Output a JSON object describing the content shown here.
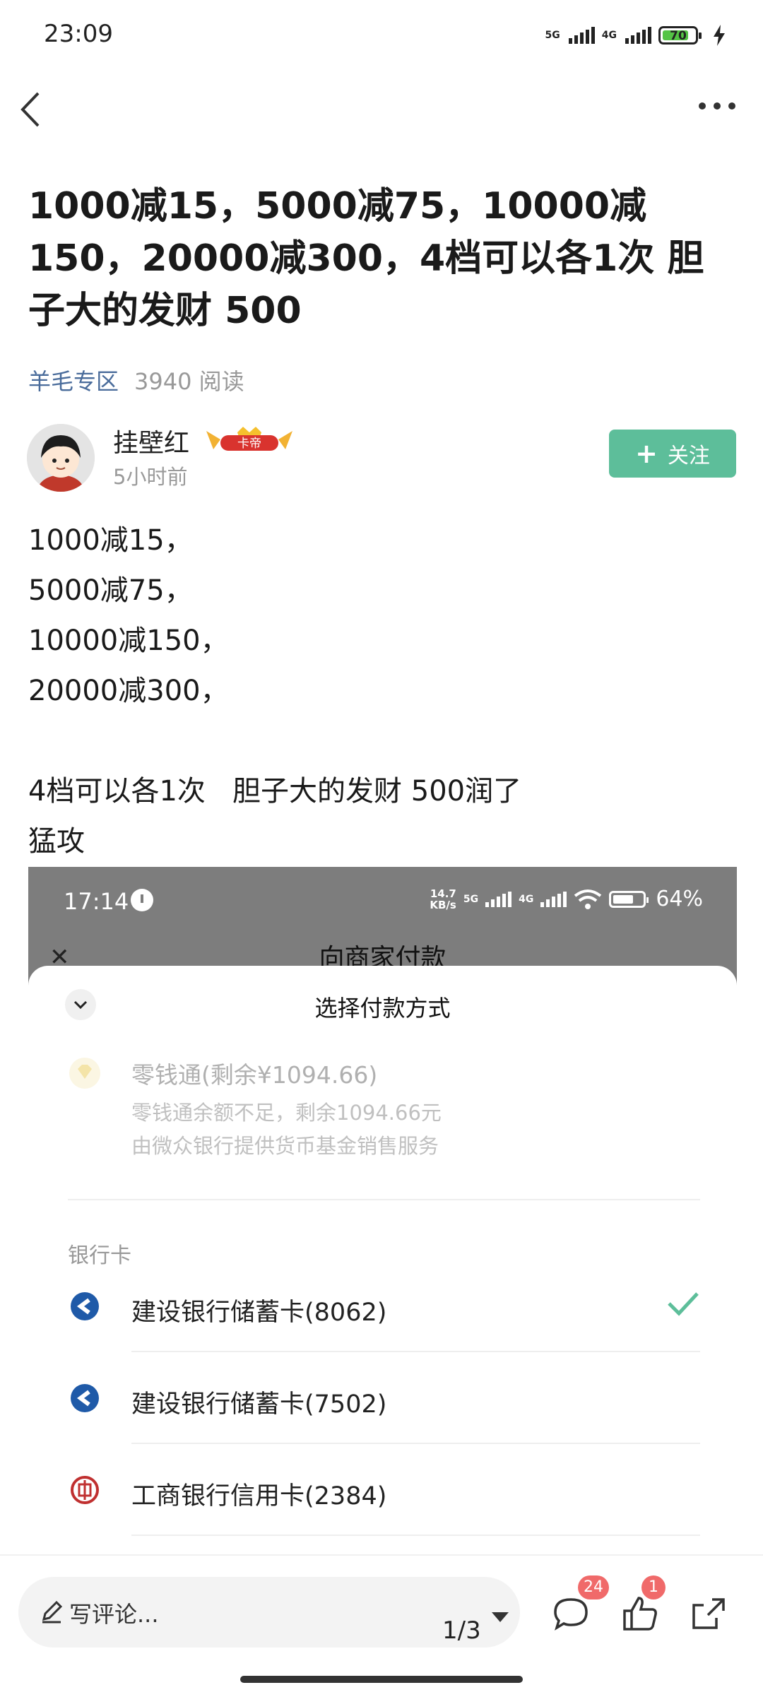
{
  "status_bar": {
    "time": "23:09",
    "net1": "5G",
    "net2": "4G",
    "battery": "70"
  },
  "post": {
    "title": "1000减15，5000减75，10000减150，20000减300，4档可以各1次 胆子大的发财 500",
    "category": "羊毛专区",
    "reads": "3940 阅读",
    "author": "挂壁红",
    "badge": "卡帝",
    "time": "5小时前",
    "follow_label": "关注",
    "body": [
      "1000减15，",
      "5000减75，",
      "10000减150，",
      "20000减300，",
      "",
      "4档可以各1次   胆子大的发财 500润了",
      "猛攻"
    ]
  },
  "screenshot": {
    "time": "17:14",
    "speed_top": "14.7",
    "speed_unit": "KB/s",
    "net1": "5G",
    "net2": "4G",
    "battery": "64%",
    "header": "向商家付款",
    "sheet_title": "选择付款方式",
    "lingqiantong": {
      "name": "零钱通(剩余¥1094.66)",
      "sub1": "零钱通余额不足，剩余1094.66元",
      "sub2": "由微众银行提供货币基金销售服务"
    },
    "bank_label": "银行卡",
    "banks": [
      {
        "name": "建设银行储蓄卡(8062)",
        "selected": true,
        "color": "#1f5aa8"
      },
      {
        "name": "建设银行储蓄卡(7502)",
        "selected": false,
        "color": "#1f5aa8"
      },
      {
        "name": "工商银行信用卡(2384)",
        "selected": false,
        "color": "#c03030"
      }
    ]
  },
  "bottom": {
    "comment_placeholder": "写评论...",
    "page": "1/3",
    "comment_count": "24",
    "like_count": "1"
  },
  "colors": {
    "accent": "#5dbe9a",
    "category": "#4a6c9b",
    "badge_red": "#f06a6a"
  }
}
